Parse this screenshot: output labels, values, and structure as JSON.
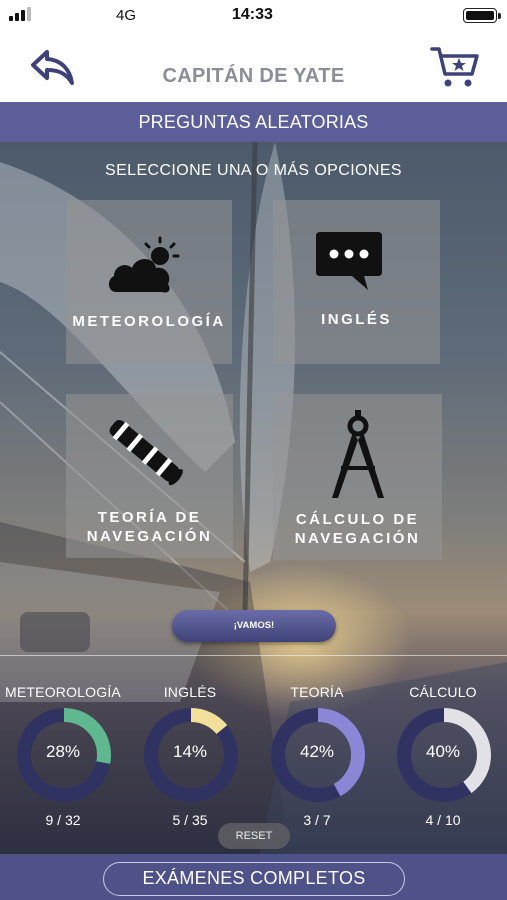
{
  "status_bar": {
    "network": "4G",
    "time": "14:33"
  },
  "header": {
    "title": "CAPITÁN DE YATE",
    "back_icon": "back-arrow-icon",
    "cart_icon": "cart-star-icon"
  },
  "section_title": "PREGUNTAS ALEATORIAS",
  "instruction": "SELECCIONE UNA O MÁS OPCIONES",
  "options": [
    {
      "label": "METEOROLOGÍA",
      "icon": "cloud-sun-icon"
    },
    {
      "label": "INGLÉS",
      "icon": "chat-bubble-icon"
    },
    {
      "label_line1": "TEORÍA DE",
      "label_line2": "NAVEGACIÓN",
      "icon": "telescope-icon"
    },
    {
      "label_line1": "CÁLCULO DE",
      "label_line2": "NAVEGACIÓN",
      "icon": "compass-divider-icon"
    }
  ],
  "go_button": "¡VAMOS!",
  "stats": [
    {
      "title": "METEOROLOGÍA",
      "percent": 28,
      "percent_text": "28%",
      "count": "9 / 32",
      "color": "#5fb88f"
    },
    {
      "title": "INGLÉS",
      "percent": 14,
      "percent_text": "14%",
      "count": "5 / 35",
      "color": "#f2df9a"
    },
    {
      "title": "TEORÍA",
      "percent": 42,
      "percent_text": "42%",
      "count": "3 / 7",
      "color": "#8b86d6"
    },
    {
      "title": "CÁLCULO",
      "percent": 40,
      "percent_text": "40%",
      "count": "4 / 10",
      "color": "#e2e2e6"
    }
  ],
  "reset_button": "RESET",
  "bottom_button": "EXÁMENES COMPLETOS",
  "colors": {
    "accent": "#5b5e98",
    "ring_track": "#303362",
    "title_gray": "#8c8d96"
  }
}
